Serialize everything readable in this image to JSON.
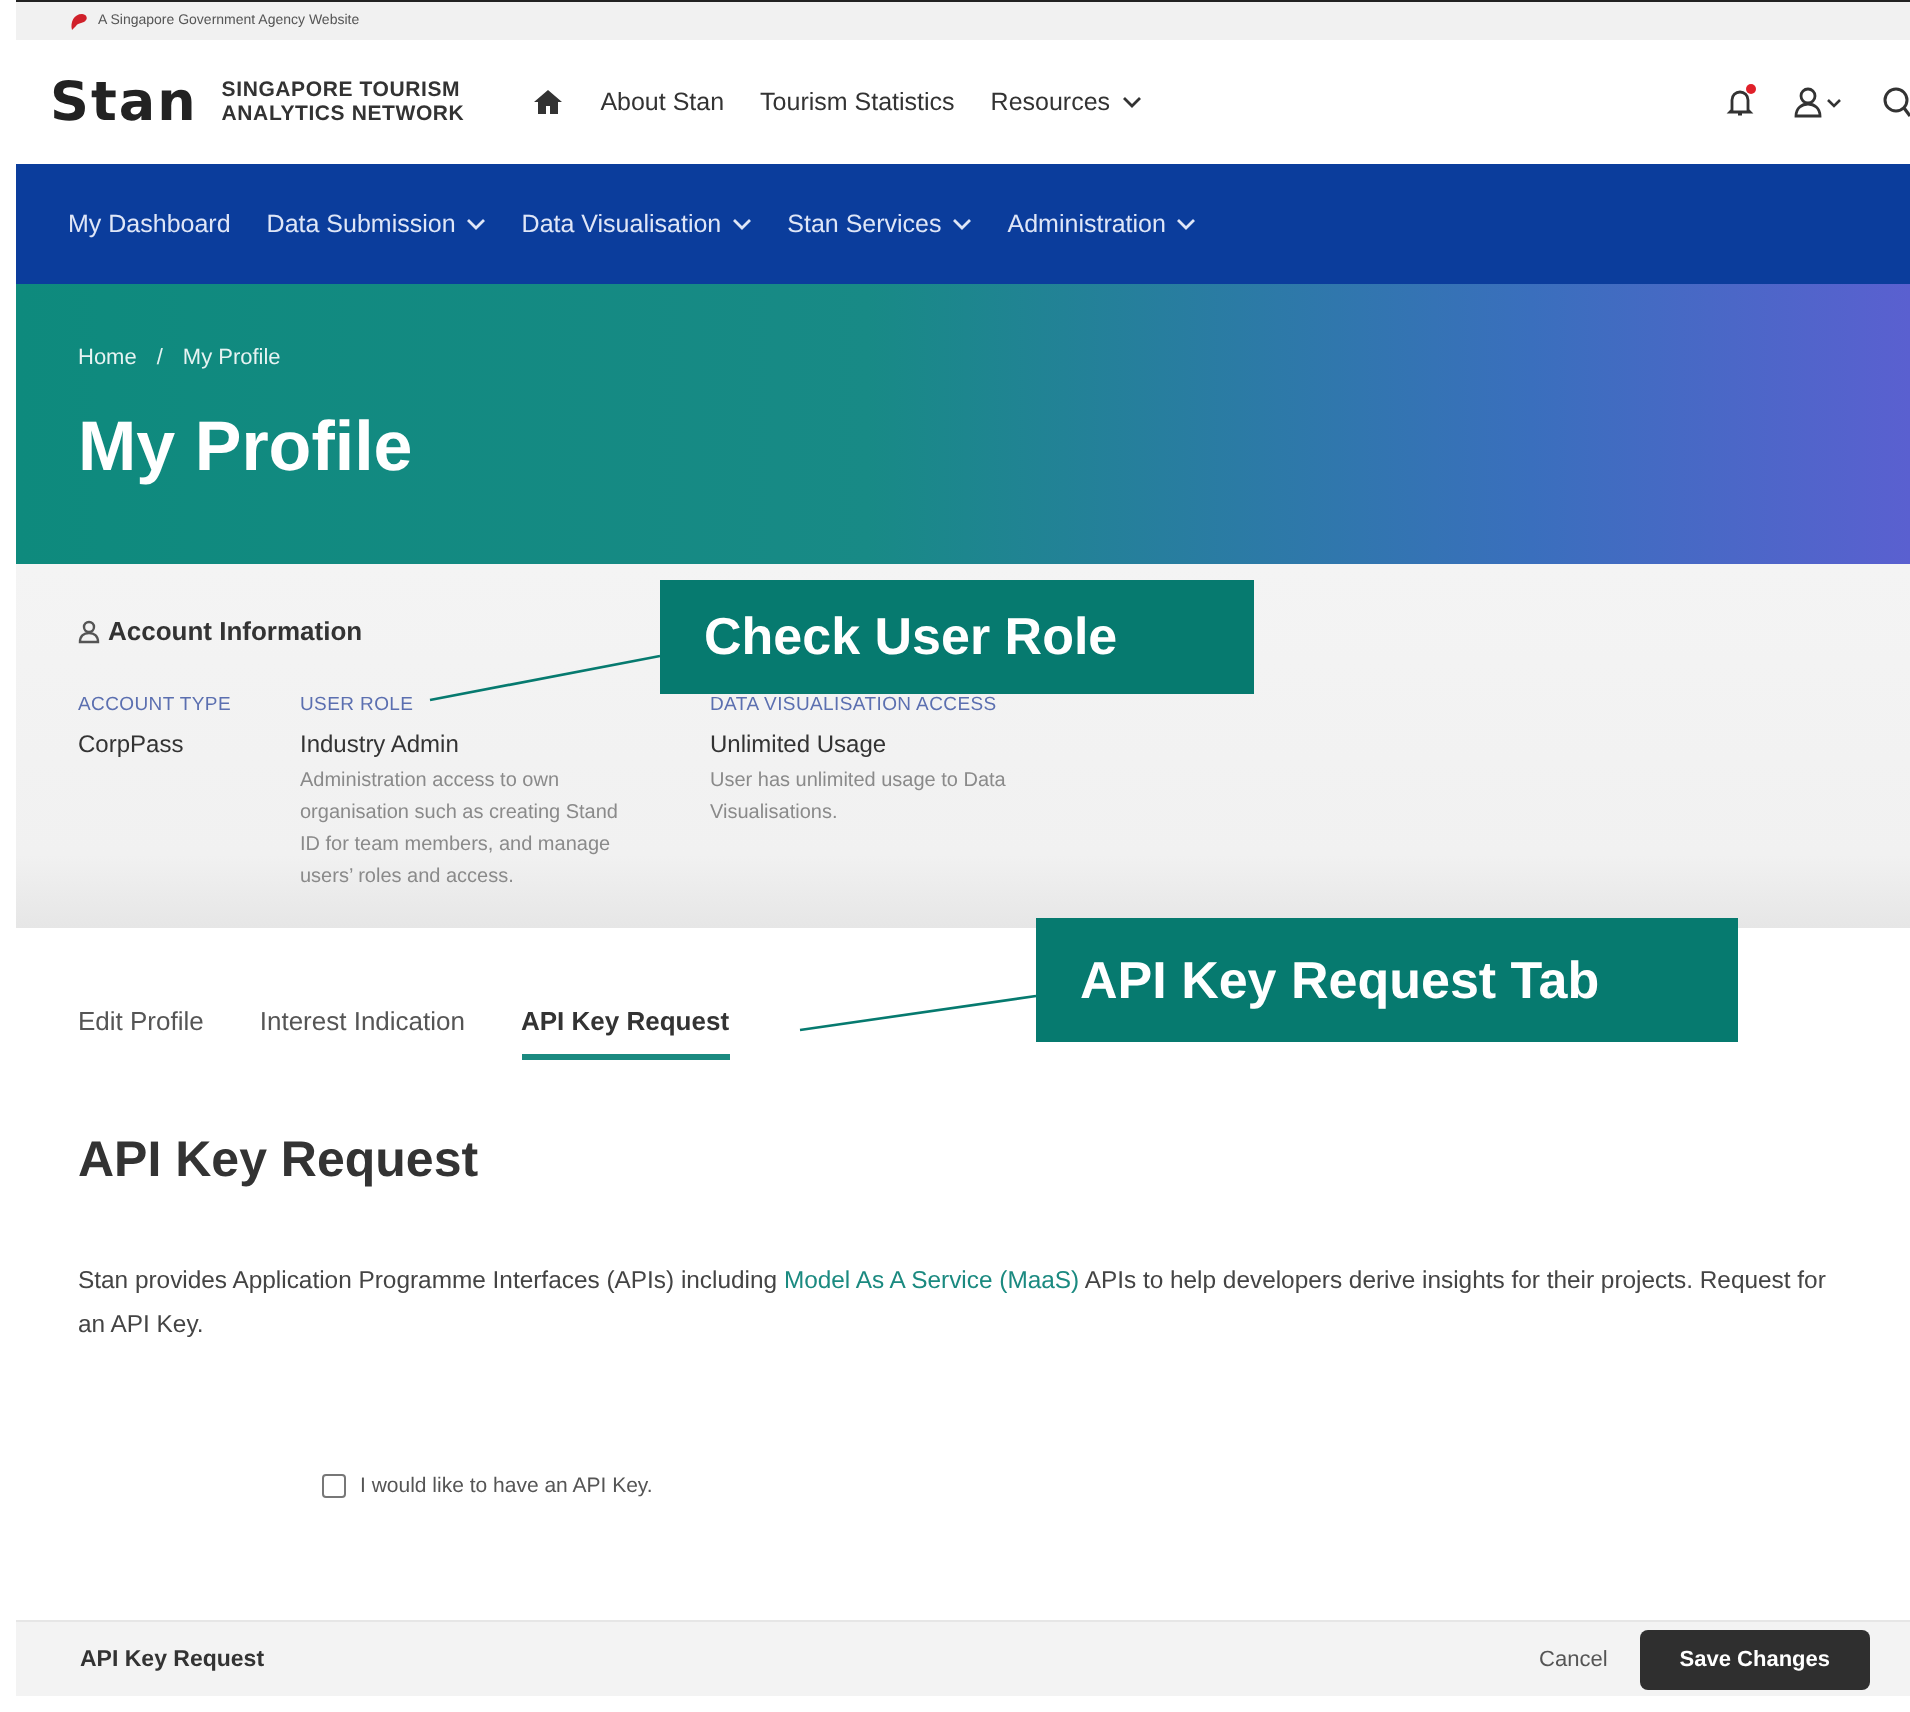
{
  "gov_banner": {
    "text": "A Singapore Government Agency Website"
  },
  "header": {
    "logo": "Stan",
    "logo_subtitle": [
      "SINGAPORE TOURISM",
      "ANALYTICS NETWORK"
    ],
    "notification_unread": true,
    "links": [
      {
        "label": "About Stan",
        "dropdown": false
      },
      {
        "label": "Tourism Statistics",
        "dropdown": false
      },
      {
        "label": "Resources",
        "dropdown": true
      }
    ]
  },
  "main_nav": [
    {
      "label": "My Dashboard",
      "dropdown": false
    },
    {
      "label": "Data Submission",
      "dropdown": true
    },
    {
      "label": "Data Visualisation",
      "dropdown": true
    },
    {
      "label": "Stan Services",
      "dropdown": true
    },
    {
      "label": "Administration",
      "dropdown": true
    }
  ],
  "hero": {
    "breadcrumb": [
      "Home",
      "My Profile"
    ],
    "breadcrumb_separator": "/",
    "title": "My Profile"
  },
  "account_info": {
    "title": "Account Information",
    "fields": [
      {
        "label": "ACCOUNT TYPE",
        "value": "CorpPass"
      },
      {
        "label": "USER ROLE",
        "value": "Industry Admin",
        "description": "Administration access to own organisation such as creating Stand ID for team members, and manage users’ roles and access."
      },
      {
        "label": "DATA VISUALISATION ACCESS",
        "value": "Unlimited Usage",
        "description": "User has unlimited usage to Data Visualisations."
      }
    ]
  },
  "tabs": [
    {
      "label": "Edit Profile",
      "selected": false
    },
    {
      "label": "Interest Indication",
      "selected": false
    },
    {
      "label": "API Key Request",
      "selected": true
    }
  ],
  "content": {
    "heading": "API Key Request",
    "text_before": "Stan provides Application Programme Interfaces (APIs) including",
    "link": "Model As A Service (MaaS)",
    "text_after": "APIs to help developers derive insights for their projects. Request for an API Key.",
    "checkbox": {
      "label": "I would like to have an API Key.",
      "checked": false
    }
  },
  "footer_bar": {
    "title": "API Key Request",
    "cancel": "Cancel",
    "save": "Save Changes"
  },
  "annotations": [
    {
      "text": "Check User Role"
    },
    {
      "text": "API Key Request Tab"
    }
  ]
}
